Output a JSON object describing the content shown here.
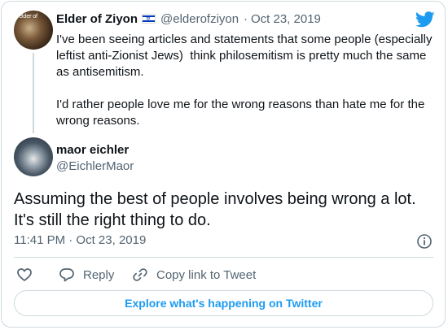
{
  "parent_tweet": {
    "name": "Elder of Ziyon",
    "handle": "@elderofziyon",
    "separator": "·",
    "date": "Oct 23, 2019",
    "avatar_text": "elder of",
    "text": "I've been seeing articles and statements that some people (especially leftist anti-Zionist Jews)  think philosemitism is pretty much the same as antisemitism.\n\nI'd rather people love me for the wrong reasons than hate me for the wrong reasons."
  },
  "main_tweet": {
    "name": "maor eichler",
    "handle": "@EichlerMaor",
    "text": "Assuming the best of people involves being wrong a lot. It's still the right thing to do.",
    "time": "11:41 PM · Oct 23, 2019"
  },
  "actions": {
    "reply_label": "Reply",
    "copy_label": "Copy link to Tweet"
  },
  "explore_label": "Explore what's happening on Twitter",
  "colors": {
    "accent": "#1d9bf0",
    "text": "#0f1419",
    "secondary": "#536471",
    "border": "#cfd9de"
  }
}
